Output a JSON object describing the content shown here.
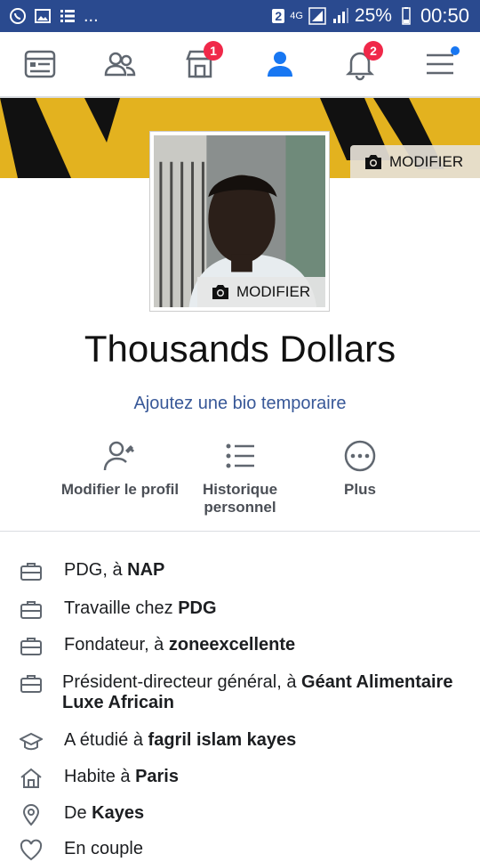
{
  "status_bar": {
    "more": "...",
    "sim": "2",
    "network": "4G",
    "battery": "25%",
    "time": "00:50"
  },
  "nav": {
    "marketplace_badge": "1",
    "notifications_badge": "2"
  },
  "cover": {
    "edit_label": "MODIFIER"
  },
  "profile_photo": {
    "edit_label": "MODIFIER"
  },
  "profile": {
    "name": "Thousands Dollars",
    "bio_link": "Ajoutez une bio temporaire"
  },
  "actions": [
    {
      "label": "Modifier le profil"
    },
    {
      "label": "Historique personnel"
    },
    {
      "label": "Plus"
    }
  ],
  "info": [
    {
      "icon": "briefcase-icon",
      "prefix": "PDG, à ",
      "bold": "NAP"
    },
    {
      "icon": "briefcase-icon",
      "prefix": "Travaille chez ",
      "bold": "PDG"
    },
    {
      "icon": "briefcase-icon",
      "prefix": "Fondateur, à ",
      "bold": "zoneexcellente"
    },
    {
      "icon": "briefcase-icon",
      "prefix": "Président-directeur général, à ",
      "bold": "Géant Alimentaire Luxe Africain"
    },
    {
      "icon": "graduation-cap-icon",
      "prefix": "A étudié à ",
      "bold": "fagril islam kayes"
    },
    {
      "icon": "house-icon",
      "prefix": "Habite à ",
      "bold": "Paris"
    },
    {
      "icon": "location-pin-icon",
      "prefix": "De ",
      "bold": "Kayes"
    },
    {
      "icon": "heart-icon",
      "prefix": "En couple",
      "bold": ""
    }
  ]
}
